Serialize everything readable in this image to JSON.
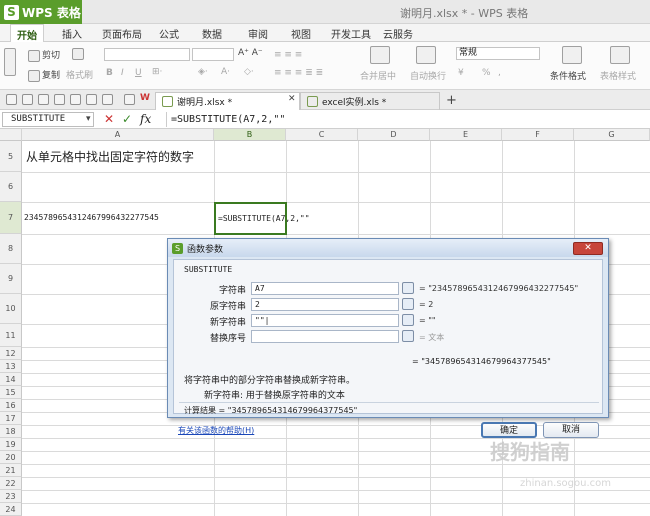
{
  "app": {
    "button_label": "WPS 表格",
    "logo_letter": "S",
    "window_title": "谢明月.xlsx * - WPS 表格"
  },
  "menu": [
    "开始",
    "插入",
    "页面布局",
    "公式",
    "数据",
    "审阅",
    "视图",
    "开发工具",
    "云服务"
  ],
  "ribbon": {
    "cut": "剪切",
    "copy": "复制",
    "format_painter": "格式刷",
    "merge_center": "合并居中",
    "wrap_text": "自动换行",
    "number_format": "常规",
    "currency": "¥",
    "percent": "%",
    "comma": ",",
    "conditional_format": "条件格式",
    "table_style": "表格样式"
  },
  "tabs": [
    {
      "label": "谢明月.xlsx *",
      "active": true
    },
    {
      "label": "excel实例.xls *",
      "active": false
    }
  ],
  "formula_bar": {
    "name_box": "SUBSTITUTE",
    "fx": "fx",
    "cancel": "✕",
    "confirm": "✓",
    "formula": "=SUBSTITUTE(A7,2,\"\""
  },
  "grid": {
    "columns": [
      "A",
      "B",
      "C",
      "D",
      "E",
      "F",
      "G"
    ],
    "rows": [
      "5",
      "6",
      "7",
      "8",
      "9",
      "10",
      "11",
      "12",
      "13",
      "14",
      "15",
      "16",
      "17",
      "18",
      "19",
      "20",
      "21",
      "22",
      "23",
      "24"
    ],
    "cells": {
      "A5": "从单元格中找出固定字符的数字",
      "A7": "2345789654312467996432277545",
      "B7": "=SUBSTITUTE(A7,2,\"\""
    }
  },
  "dialog": {
    "title": "函数参数",
    "close": "✕",
    "function_name": "SUBSTITUTE",
    "args": [
      {
        "label": "字符串",
        "value": "A7",
        "result": "= \"2345789654312467996432277545\""
      },
      {
        "label": "原字符串",
        "value": "2",
        "result": "= 2"
      },
      {
        "label": "新字符串",
        "value": "\"\"|",
        "result": "= \"\""
      },
      {
        "label": "替换序号",
        "value": "",
        "result": "= 文本"
      }
    ],
    "function_result": "= \"345789654314679964377545\"",
    "description": "将字符串中的部分字符串替换成新字符串。",
    "param_desc": "新字符串:  用于替换原字符串的文本",
    "calc_result": "计算结果 = \"345789654314679964377545\"",
    "help_link": "有关该函数的帮助(H)",
    "ok": "确定",
    "cancel": "取消"
  },
  "watermark": {
    "text": "搜狗指南",
    "url": "zhinan.sogou.com"
  }
}
